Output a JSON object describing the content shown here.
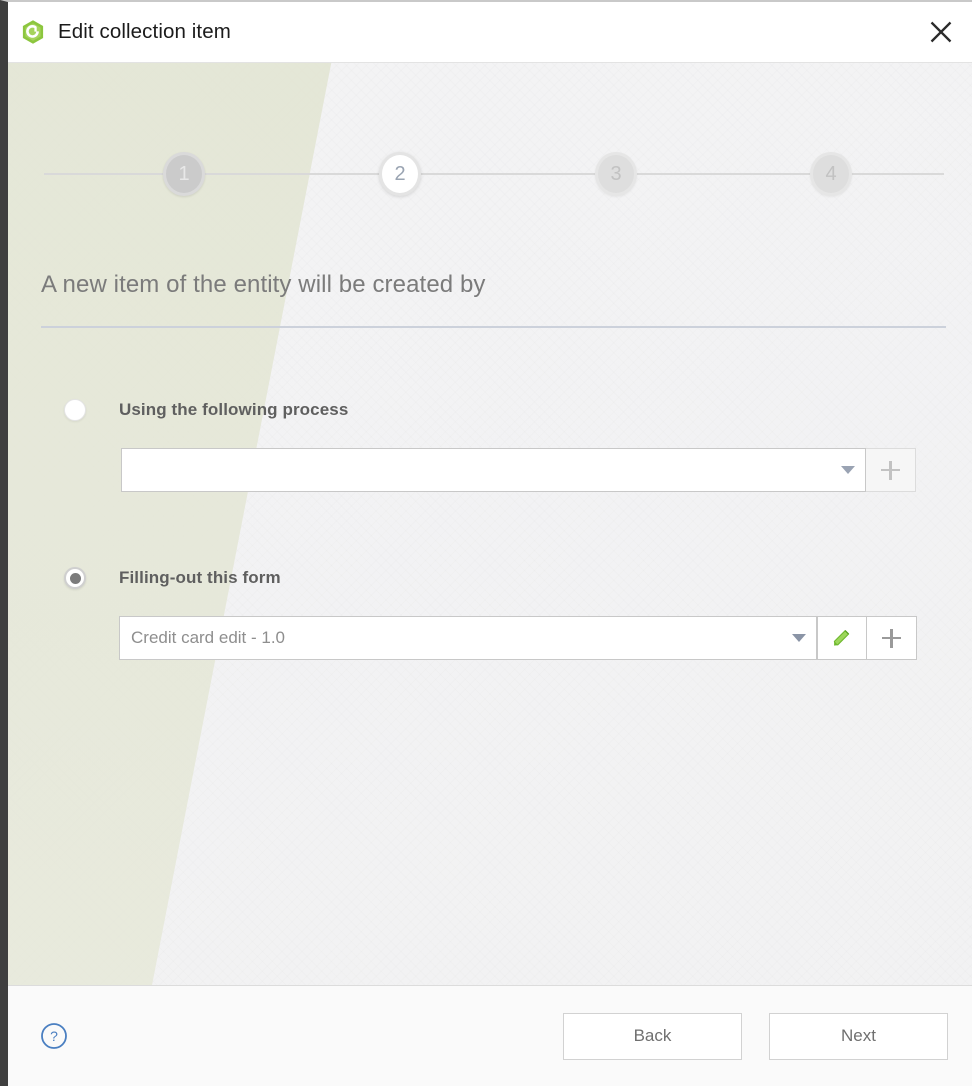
{
  "window": {
    "title": "Edit collection item",
    "app_icon": "hexagon-logo-icon",
    "close_label": "close-icon",
    "accent_green": "#8cc63e",
    "accent_blue": "#4a90d9"
  },
  "stepper": {
    "steps": [
      {
        "number": "1",
        "state": "done"
      },
      {
        "number": "2",
        "state": "active"
      },
      {
        "number": "3",
        "state": "todo"
      },
      {
        "number": "4",
        "state": "todo"
      }
    ]
  },
  "main": {
    "heading": "A new item of the entity will be created by",
    "options": [
      {
        "label": "Using the following process",
        "selected": false,
        "combo_value": "",
        "combo_placeholder": "",
        "has_edit_button": false,
        "add_button_enabled": false,
        "add_label": "+"
      },
      {
        "label": "Filling-out this form",
        "selected": true,
        "combo_value": "Credit card edit - 1.0",
        "combo_placeholder": "",
        "has_edit_button": true,
        "edit_label": "pencil-icon",
        "add_button_enabled": true,
        "add_label": "+"
      }
    ]
  },
  "footer": {
    "help_label": "help-icon",
    "back_label": "Back",
    "next_label": "Next"
  }
}
